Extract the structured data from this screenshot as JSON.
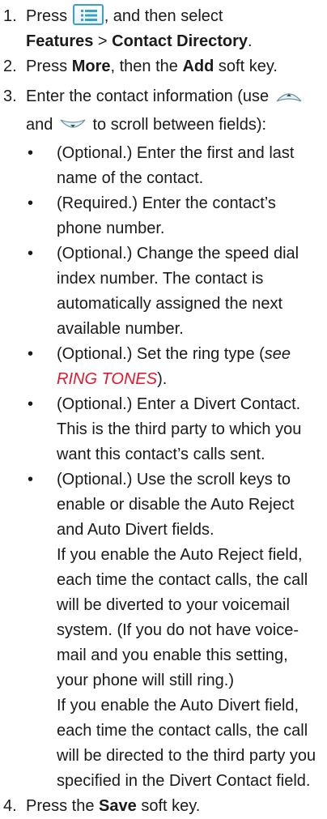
{
  "steps": [
    {
      "number": "1.",
      "parts": {
        "press": "Press ",
        "after_icon": ", and then select",
        "features": "Features",
        "sep": " > ",
        "contact_directory": "Contact Directory",
        "end": "."
      },
      "icon": "menu-key-icon"
    },
    {
      "number": "2.",
      "parts": {
        "a": "Press ",
        "more": "More",
        "b": ", then the ",
        "add": "Add",
        "c": " soft key."
      }
    },
    {
      "number": "3.",
      "parts": {
        "a": "Enter the contact information (use ",
        "b": "and ",
        "c": " to scroll between fields):"
      },
      "icons": [
        "scroll-up-key-icon",
        "scroll-down-key-icon"
      ],
      "bullets": [
        "(Optional.) Enter the first and last name of the contact.",
        "(Required.) Enter the contact’s phone number.",
        "(Optional.) Change the speed dial index number. The contact is automatically assigned the next available number.",
        {
          "a": "(Optional.) Set the ring type (",
          "see": "see",
          "link": "RING TONES",
          "b": ")."
        },
        "(Optional.) Enter a Divert Contact. This is the third party to which you want this contact’s calls sent.",
        "(Optional.) Use the scroll keys to enable or disable the Auto Reject and Auto Divert fields."
      ],
      "notes": [
        "If you enable the Auto Reject field, each time the contact calls, the call will be diverted to your voicemail system. (If you do not have voice-mail and you enable this setting, your phone will still ring.)",
        "If you enable the Auto Divert field, each time the contact calls, the call will be directed to the third party you specified in the Divert Contact field."
      ]
    },
    {
      "number": "4.",
      "parts": {
        "a": "Press the ",
        "save": "Save",
        "b": " soft key."
      }
    }
  ],
  "colors": {
    "link": "#e0192d",
    "key_border": "#3aa0c8",
    "text": "#1a1a1a"
  }
}
